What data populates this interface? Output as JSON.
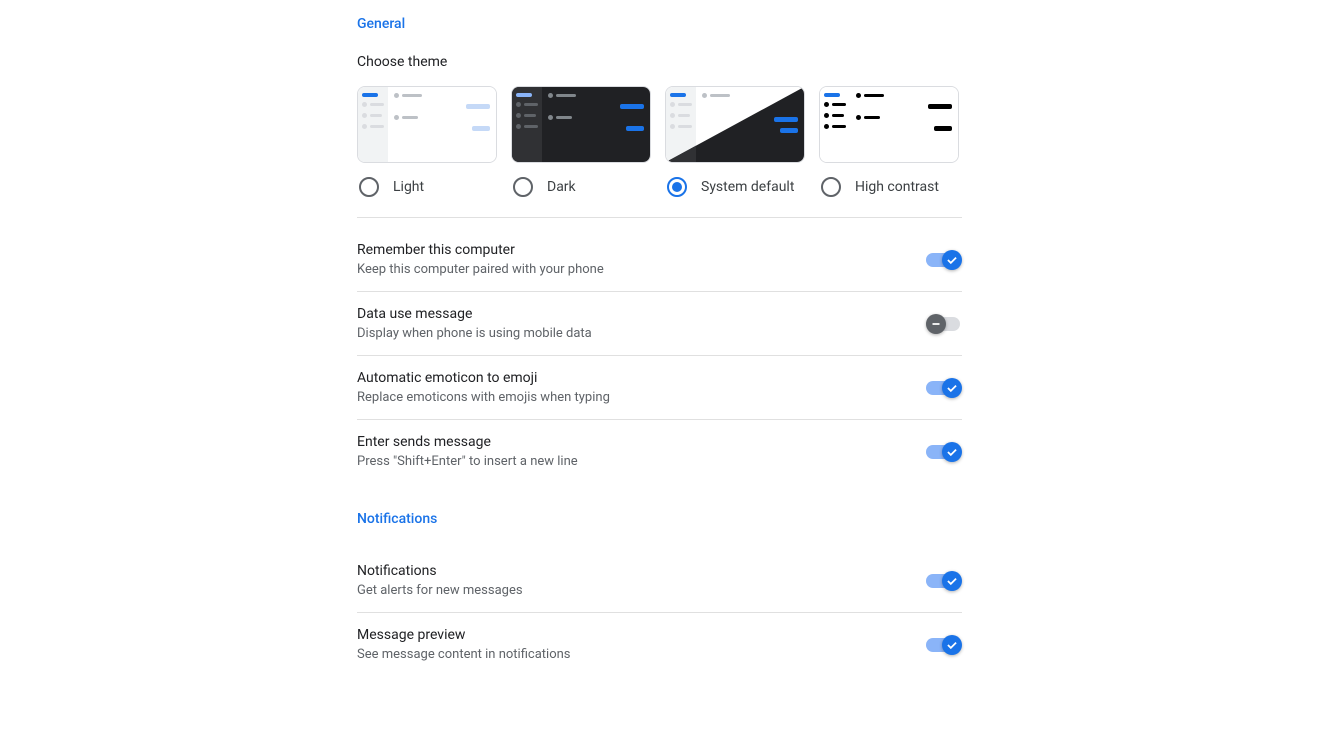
{
  "sections": {
    "general": {
      "title": "General"
    },
    "notifications": {
      "title": "Notifications"
    }
  },
  "theme": {
    "label": "Choose theme",
    "options": [
      {
        "id": "light",
        "label": "Light",
        "selected": false
      },
      {
        "id": "dark",
        "label": "Dark",
        "selected": false
      },
      {
        "id": "system",
        "label": "System default",
        "selected": true
      },
      {
        "id": "high_contrast",
        "label": "High contrast",
        "selected": false
      }
    ]
  },
  "settings": [
    {
      "title": "Remember this computer",
      "desc": "Keep this computer paired with your phone",
      "on": true
    },
    {
      "title": "Data use message",
      "desc": "Display when phone is using mobile data",
      "on": false
    },
    {
      "title": "Automatic emoticon to emoji",
      "desc": "Replace emoticons with emojis when typing",
      "on": true
    },
    {
      "title": "Enter sends message",
      "desc": "Press \"Shift+Enter\" to insert a new line",
      "on": true
    }
  ],
  "notif_settings": [
    {
      "title": "Notifications",
      "desc": "Get alerts for new messages",
      "on": true
    },
    {
      "title": "Message preview",
      "desc": "See message content in notifications",
      "on": true
    }
  ]
}
